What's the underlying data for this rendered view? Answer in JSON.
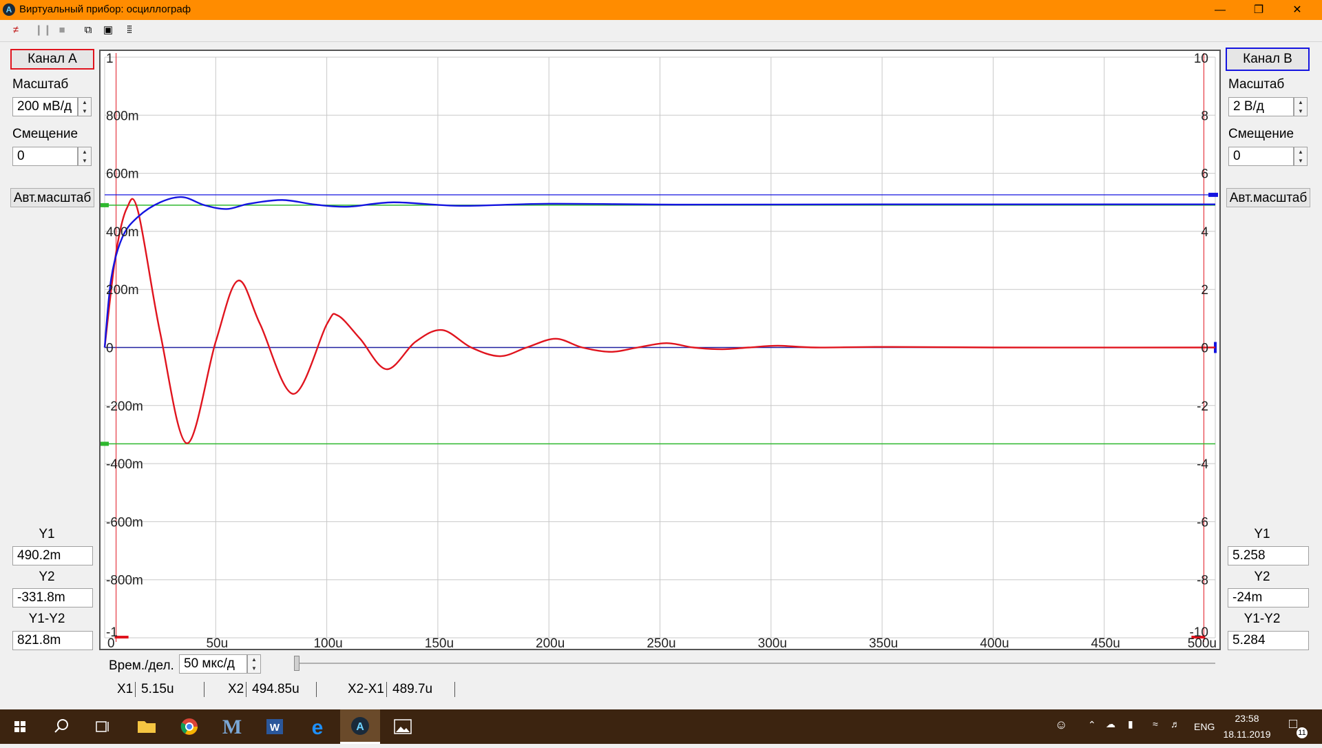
{
  "window": {
    "title": "Виртуальный прибор: осциллограф"
  },
  "channel_a": {
    "button_label": "Канал А",
    "scale_label": "Масштаб",
    "scale_value": "200 мВ/д",
    "offset_label": "Смещение",
    "offset_value": "0",
    "autoscale_label": "Авт.масштаб",
    "y1_label": "Y1",
    "y1_value": "490.2m",
    "y2_label": "Y2",
    "y2_value": "-331.8m",
    "diff_label": "Y1-Y2",
    "diff_value": "821.8m",
    "color": "#e0141e"
  },
  "channel_b": {
    "button_label": "Канал В",
    "scale_label": "Масштаб",
    "scale_value": "2 В/д",
    "offset_label": "Смещение",
    "offset_value": "0",
    "autoscale_label": "Авт.масштаб",
    "y1_label": "Y1",
    "y1_value": "5.258",
    "y2_label": "Y2",
    "y2_value": "-24m",
    "diff_label": "Y1-Y2",
    "diff_value": "5.284",
    "color": "#1414e0"
  },
  "time": {
    "label": "Врем./дел.",
    "value": "50 мкс/д",
    "x1_label": "X1",
    "x1_value": "5.15u",
    "x2_label": "X2",
    "x2_value": "494.85u",
    "dx_label": "X2-X1",
    "dx_value": "489.7u"
  },
  "taskbar": {
    "lang": "ENG",
    "time": "23:58",
    "date": "18.11.2019",
    "notifications": "11",
    "icons": [
      "start-icon",
      "search-icon",
      "task-view-icon",
      "file-explorer-icon",
      "chrome-icon",
      "m-app-icon",
      "word-icon",
      "edge-icon",
      "oscilloscope-app-icon",
      "photos-icon"
    ]
  },
  "chart_data": {
    "type": "line",
    "x_ticks": [
      "0",
      "50u",
      "100u",
      "150u",
      "200u",
      "250u",
      "300u",
      "350u",
      "400u",
      "450u",
      "500u"
    ],
    "y_left_ticks": [
      "1",
      "800m",
      "600m",
      "400m",
      "200m",
      "0",
      "-200m",
      "-400m",
      "-600m",
      "-800m",
      "-1"
    ],
    "y_right_ticks": [
      "10",
      "8",
      "6",
      "4",
      "2",
      "0",
      "-2",
      "-4",
      "-6",
      "-8",
      "-10"
    ],
    "xlim": [
      0,
      500
    ],
    "ylim_left": [
      -1,
      1
    ],
    "ylim_right": [
      -10,
      10
    ],
    "grid": true,
    "series": [
      {
        "color": "#e0141e",
        "axis": "left",
        "x": [
          0,
          5,
          10,
          15,
          25,
          37,
          50,
          60,
          70,
          85,
          100,
          105,
          115,
          127,
          140,
          152,
          165,
          178,
          190,
          203,
          215,
          228,
          240,
          253,
          265,
          278,
          290,
          303,
          320,
          350,
          400,
          500
        ],
        "y": [
          0,
          0.32,
          0.48,
          0.47,
          0.05,
          -0.33,
          0.02,
          0.23,
          0.08,
          -0.16,
          0.08,
          0.11,
          0.03,
          -0.075,
          0.02,
          0.06,
          0.0,
          -0.03,
          0.0,
          0.03,
          0.0,
          -0.015,
          0.0,
          0.015,
          0.0,
          -0.006,
          0.0,
          0.006,
          0.0,
          0.002,
          0.0,
          0.0
        ]
      },
      {
        "color": "#1414e0",
        "axis": "right",
        "x": [
          0,
          3,
          8,
          15,
          25,
          35,
          45,
          55,
          65,
          80,
          95,
          110,
          130,
          160,
          200,
          260,
          350,
          500
        ],
        "y": [
          0,
          2.4,
          3.8,
          4.5,
          5.0,
          5.18,
          4.9,
          4.77,
          4.95,
          5.08,
          4.92,
          4.85,
          5.0,
          4.88,
          4.95,
          4.92,
          4.93,
          4.93
        ]
      }
    ],
    "cursors": {
      "x1": 5.15,
      "x2": 494.85,
      "y1_left": 0.4902,
      "y2_left": -0.3318,
      "y1_right": 5.258,
      "y2_right": -0.024
    }
  }
}
